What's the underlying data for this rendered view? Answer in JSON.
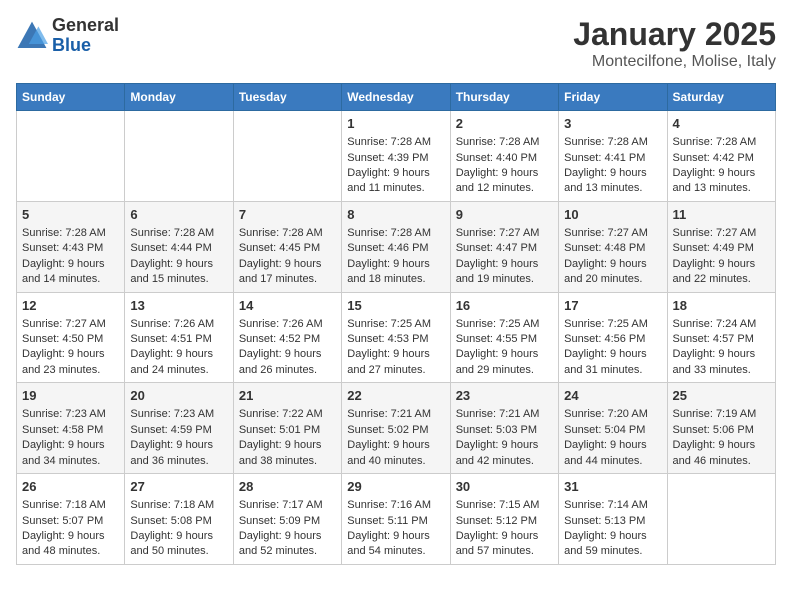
{
  "header": {
    "logo_general": "General",
    "logo_blue": "Blue",
    "title": "January 2025",
    "subtitle": "Montecilfone, Molise, Italy"
  },
  "calendar": {
    "days_of_week": [
      "Sunday",
      "Monday",
      "Tuesday",
      "Wednesday",
      "Thursday",
      "Friday",
      "Saturday"
    ],
    "weeks": [
      [
        {
          "day": "",
          "info": ""
        },
        {
          "day": "",
          "info": ""
        },
        {
          "day": "",
          "info": ""
        },
        {
          "day": "1",
          "info": "Sunrise: 7:28 AM\nSunset: 4:39 PM\nDaylight: 9 hours\nand 11 minutes."
        },
        {
          "day": "2",
          "info": "Sunrise: 7:28 AM\nSunset: 4:40 PM\nDaylight: 9 hours\nand 12 minutes."
        },
        {
          "day": "3",
          "info": "Sunrise: 7:28 AM\nSunset: 4:41 PM\nDaylight: 9 hours\nand 13 minutes."
        },
        {
          "day": "4",
          "info": "Sunrise: 7:28 AM\nSunset: 4:42 PM\nDaylight: 9 hours\nand 13 minutes."
        }
      ],
      [
        {
          "day": "5",
          "info": "Sunrise: 7:28 AM\nSunset: 4:43 PM\nDaylight: 9 hours\nand 14 minutes."
        },
        {
          "day": "6",
          "info": "Sunrise: 7:28 AM\nSunset: 4:44 PM\nDaylight: 9 hours\nand 15 minutes."
        },
        {
          "day": "7",
          "info": "Sunrise: 7:28 AM\nSunset: 4:45 PM\nDaylight: 9 hours\nand 17 minutes."
        },
        {
          "day": "8",
          "info": "Sunrise: 7:28 AM\nSunset: 4:46 PM\nDaylight: 9 hours\nand 18 minutes."
        },
        {
          "day": "9",
          "info": "Sunrise: 7:27 AM\nSunset: 4:47 PM\nDaylight: 9 hours\nand 19 minutes."
        },
        {
          "day": "10",
          "info": "Sunrise: 7:27 AM\nSunset: 4:48 PM\nDaylight: 9 hours\nand 20 minutes."
        },
        {
          "day": "11",
          "info": "Sunrise: 7:27 AM\nSunset: 4:49 PM\nDaylight: 9 hours\nand 22 minutes."
        }
      ],
      [
        {
          "day": "12",
          "info": "Sunrise: 7:27 AM\nSunset: 4:50 PM\nDaylight: 9 hours\nand 23 minutes."
        },
        {
          "day": "13",
          "info": "Sunrise: 7:26 AM\nSunset: 4:51 PM\nDaylight: 9 hours\nand 24 minutes."
        },
        {
          "day": "14",
          "info": "Sunrise: 7:26 AM\nSunset: 4:52 PM\nDaylight: 9 hours\nand 26 minutes."
        },
        {
          "day": "15",
          "info": "Sunrise: 7:25 AM\nSunset: 4:53 PM\nDaylight: 9 hours\nand 27 minutes."
        },
        {
          "day": "16",
          "info": "Sunrise: 7:25 AM\nSunset: 4:55 PM\nDaylight: 9 hours\nand 29 minutes."
        },
        {
          "day": "17",
          "info": "Sunrise: 7:25 AM\nSunset: 4:56 PM\nDaylight: 9 hours\nand 31 minutes."
        },
        {
          "day": "18",
          "info": "Sunrise: 7:24 AM\nSunset: 4:57 PM\nDaylight: 9 hours\nand 33 minutes."
        }
      ],
      [
        {
          "day": "19",
          "info": "Sunrise: 7:23 AM\nSunset: 4:58 PM\nDaylight: 9 hours\nand 34 minutes."
        },
        {
          "day": "20",
          "info": "Sunrise: 7:23 AM\nSunset: 4:59 PM\nDaylight: 9 hours\nand 36 minutes."
        },
        {
          "day": "21",
          "info": "Sunrise: 7:22 AM\nSunset: 5:01 PM\nDaylight: 9 hours\nand 38 minutes."
        },
        {
          "day": "22",
          "info": "Sunrise: 7:21 AM\nSunset: 5:02 PM\nDaylight: 9 hours\nand 40 minutes."
        },
        {
          "day": "23",
          "info": "Sunrise: 7:21 AM\nSunset: 5:03 PM\nDaylight: 9 hours\nand 42 minutes."
        },
        {
          "day": "24",
          "info": "Sunrise: 7:20 AM\nSunset: 5:04 PM\nDaylight: 9 hours\nand 44 minutes."
        },
        {
          "day": "25",
          "info": "Sunrise: 7:19 AM\nSunset: 5:06 PM\nDaylight: 9 hours\nand 46 minutes."
        }
      ],
      [
        {
          "day": "26",
          "info": "Sunrise: 7:18 AM\nSunset: 5:07 PM\nDaylight: 9 hours\nand 48 minutes."
        },
        {
          "day": "27",
          "info": "Sunrise: 7:18 AM\nSunset: 5:08 PM\nDaylight: 9 hours\nand 50 minutes."
        },
        {
          "day": "28",
          "info": "Sunrise: 7:17 AM\nSunset: 5:09 PM\nDaylight: 9 hours\nand 52 minutes."
        },
        {
          "day": "29",
          "info": "Sunrise: 7:16 AM\nSunset: 5:11 PM\nDaylight: 9 hours\nand 54 minutes."
        },
        {
          "day": "30",
          "info": "Sunrise: 7:15 AM\nSunset: 5:12 PM\nDaylight: 9 hours\nand 57 minutes."
        },
        {
          "day": "31",
          "info": "Sunrise: 7:14 AM\nSunset: 5:13 PM\nDaylight: 9 hours\nand 59 minutes."
        },
        {
          "day": "",
          "info": ""
        }
      ]
    ]
  }
}
